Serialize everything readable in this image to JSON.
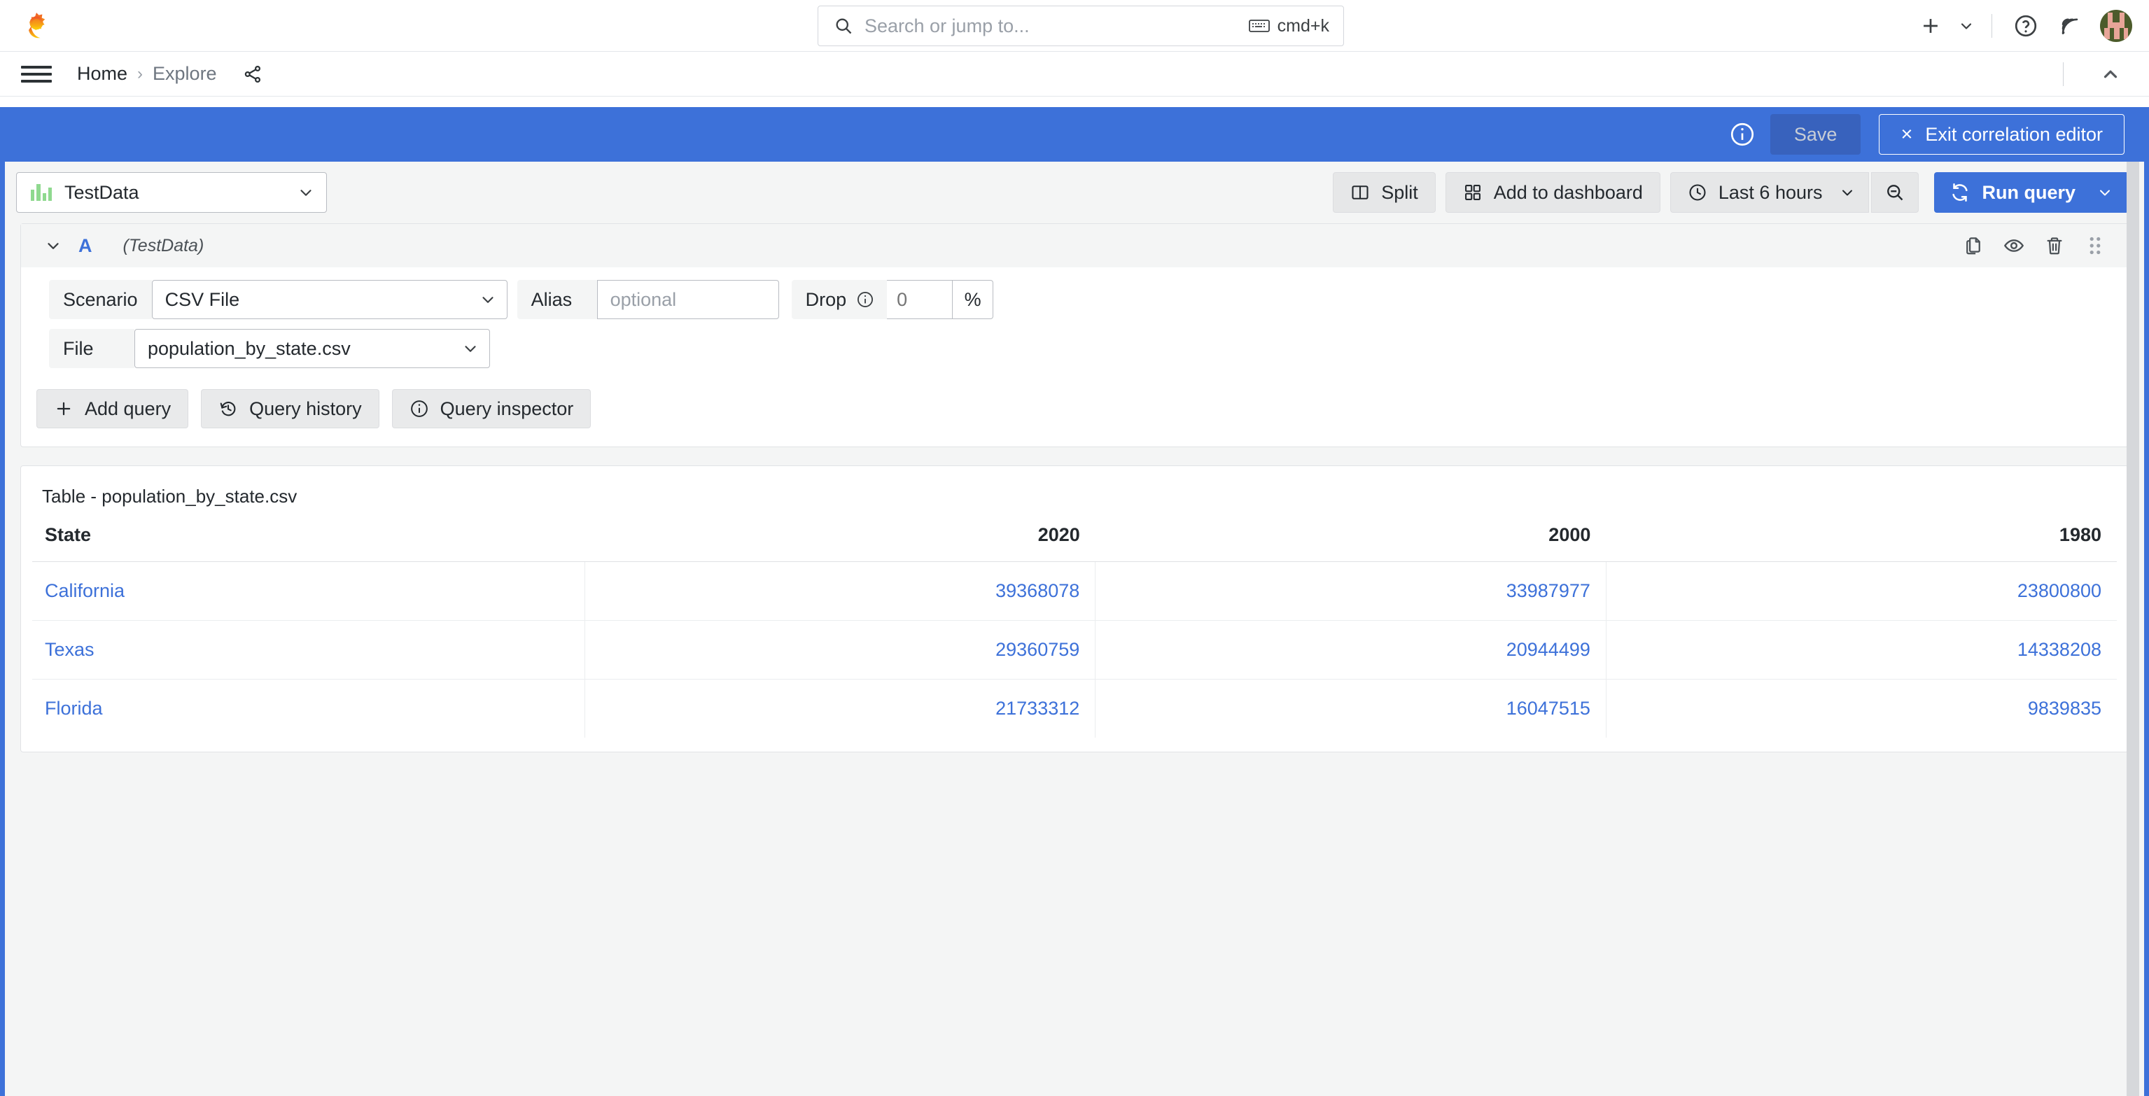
{
  "topbar": {
    "logo_icon": "grafana-logo-icon",
    "search": {
      "placeholder": "Search or jump to...",
      "icon": "search-icon",
      "shortcut": "cmd+k",
      "shortcut_icon": "keyboard-icon"
    },
    "actions": {
      "plus_icon": "plus-icon",
      "plus_caret_icon": "chevron-down-icon",
      "help_icon": "question-circle-icon",
      "news_icon": "rss-icon",
      "avatar": "user-avatar"
    }
  },
  "breadcrumb": {
    "menu_icon": "hamburger-menu-icon",
    "items": [
      {
        "label": "Home"
      },
      {
        "label": "Explore"
      }
    ],
    "separator": "›",
    "share_icon": "share-nodes-icon",
    "collapse_icon": "chevron-up-icon"
  },
  "correlation_bar": {
    "info_icon": "info-circle-icon",
    "save_label": "Save",
    "exit_label": "Exit correlation editor",
    "exit_icon": "close-x-icon",
    "accent_color": "#3d71d9",
    "save_bg": "#3862bd"
  },
  "toolbar": {
    "datasource": {
      "name": "TestData",
      "icon": "testdata-datasource-icon",
      "caret_icon": "chevron-down-icon"
    },
    "split_label": "Split",
    "split_icon": "split-panes-icon",
    "add_to_dashboard_label": "Add to dashboard",
    "add_to_dashboard_icon": "apps-grid-icon",
    "time_range_label": "Last 6 hours",
    "time_range_icon": "clock-icon",
    "time_range_caret_icon": "chevron-down-icon",
    "zoom_out_icon": "zoom-out-icon",
    "run_query_label": "Run query",
    "run_query_icon": "sync-refresh-icon",
    "run_query_caret_icon": "chevron-down-icon"
  },
  "query": {
    "collapse_icon": "chevron-down-icon",
    "ref_id": "A",
    "datasource_note": "(TestData)",
    "row_actions": {
      "copy_icon": "copy-icon",
      "hide_icon": "eye-icon",
      "delete_icon": "trash-icon",
      "drag_icon": "drag-handle-icon"
    },
    "fields": {
      "scenario_label": "Scenario",
      "scenario_value": "CSV File",
      "alias_label": "Alias",
      "alias_value": "",
      "alias_placeholder": "optional",
      "drop_label": "Drop",
      "drop_info_icon": "info-circle-icon",
      "drop_value": "",
      "drop_placeholder": "0",
      "drop_unit": "%",
      "file_label": "File",
      "file_value": "population_by_state.csv",
      "caret_icon": "chevron-down-icon"
    },
    "footer": {
      "add_query_label": "Add query",
      "add_query_icon": "plus-icon",
      "query_history_label": "Query history",
      "query_history_icon": "history-icon",
      "query_inspector_label": "Query inspector",
      "query_inspector_icon": "info-circle-icon"
    }
  },
  "table_panel": {
    "title": "Table - population_by_state.csv",
    "columns": [
      {
        "label": "State",
        "align": "left"
      },
      {
        "label": "2020",
        "align": "right"
      },
      {
        "label": "2000",
        "align": "right"
      },
      {
        "label": "1980",
        "align": "right"
      }
    ],
    "rows": [
      {
        "state": "California",
        "y2020": "39368078",
        "y2000": "33987977",
        "y1980": "23800800"
      },
      {
        "state": "Texas",
        "y2020": "29360759",
        "y2000": "20944499",
        "y1980": "14338208"
      },
      {
        "state": "Florida",
        "y2020": "21733312",
        "y2000": "16047515",
        "y1980": "9839835"
      }
    ],
    "cell_color": "#3d71d9"
  },
  "chart_data": {
    "type": "table",
    "title": "Table - population_by_state.csv",
    "columns": [
      "State",
      "2020",
      "2000",
      "1980"
    ],
    "rows": [
      [
        "California",
        39368078,
        33987977,
        23800800
      ],
      [
        "Texas",
        29360759,
        20944499,
        14338208
      ],
      [
        "Florida",
        21733312,
        16047515,
        9839835
      ]
    ]
  }
}
